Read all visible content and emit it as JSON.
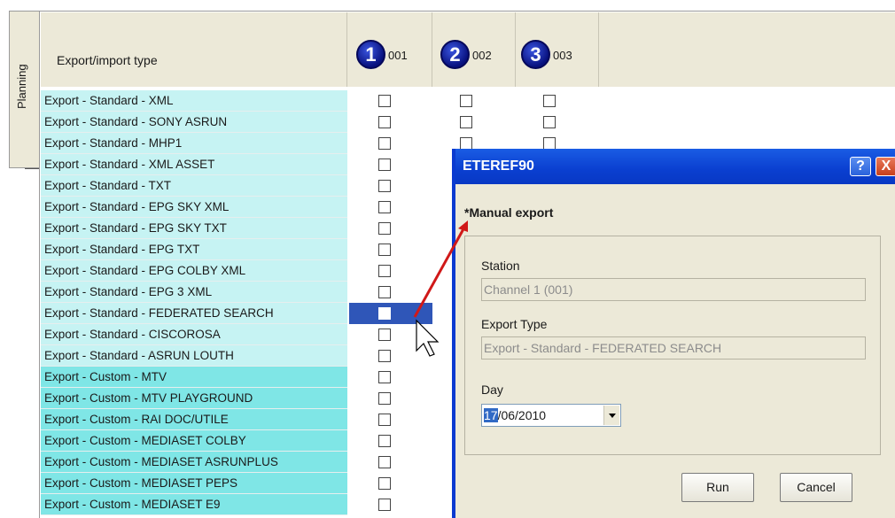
{
  "side_tab": {
    "label": "Planning"
  },
  "grid": {
    "type_header": "Export/import type",
    "columns": [
      {
        "badge": "1",
        "code": "001"
      },
      {
        "badge": "2",
        "code": "002"
      },
      {
        "badge": "3",
        "code": "003"
      }
    ],
    "rows": [
      {
        "label": "Export - Standard - XML",
        "kind": "standard"
      },
      {
        "label": "Export - Standard - SONY ASRUN",
        "kind": "standard"
      },
      {
        "label": "Export - Standard - MHP1",
        "kind": "standard"
      },
      {
        "label": "Export - Standard - XML ASSET",
        "kind": "standard"
      },
      {
        "label": "Export - Standard - TXT",
        "kind": "standard"
      },
      {
        "label": "Export - Standard - EPG SKY XML",
        "kind": "standard"
      },
      {
        "label": "Export - Standard - EPG SKY TXT",
        "kind": "standard"
      },
      {
        "label": "Export - Standard - EPG TXT",
        "kind": "standard"
      },
      {
        "label": "Export - Standard - EPG COLBY XML",
        "kind": "standard"
      },
      {
        "label": "Export - Standard - EPG 3 XML",
        "kind": "standard"
      },
      {
        "label": "Export - Standard - FEDERATED SEARCH",
        "kind": "standard",
        "selected": true
      },
      {
        "label": "Export - Standard - CISCOROSA",
        "kind": "standard"
      },
      {
        "label": "Export - Standard - ASRUN LOUTH",
        "kind": "standard"
      },
      {
        "label": "Export - Custom - MTV",
        "kind": "custom"
      },
      {
        "label": "Export - Custom - MTV PLAYGROUND",
        "kind": "custom"
      },
      {
        "label": "Export - Custom - RAI DOC/UTILE",
        "kind": "custom"
      },
      {
        "label": "Export - Custom - MEDIASET COLBY",
        "kind": "custom"
      },
      {
        "label": "Export - Custom - MEDIASET ASRUNPLUS",
        "kind": "custom"
      },
      {
        "label": "Export - Custom - MEDIASET PEPS",
        "kind": "custom"
      },
      {
        "label": "Export - Custom - MEDIASET E9",
        "kind": "custom"
      }
    ]
  },
  "dialog": {
    "title": "ETEREF90",
    "help_label": "?",
    "close_label": "X",
    "heading": "*Manual export",
    "station_label": "Station",
    "station_value": "Channel 1  (001)",
    "export_type_label": "Export Type",
    "export_type_value": "Export - Standard - FEDERATED SEARCH",
    "day_label": "Day",
    "day_selected": "17",
    "day_rest": "/06/2010",
    "run_label": "Run",
    "cancel_label": "Cancel"
  },
  "colors": {
    "standard_row": "#c6f3f3",
    "custom_row": "#7fe6e6",
    "selection": "#2f56b8",
    "titlebar": "#0a3fd0",
    "annotation_arrow": "#d01818"
  }
}
